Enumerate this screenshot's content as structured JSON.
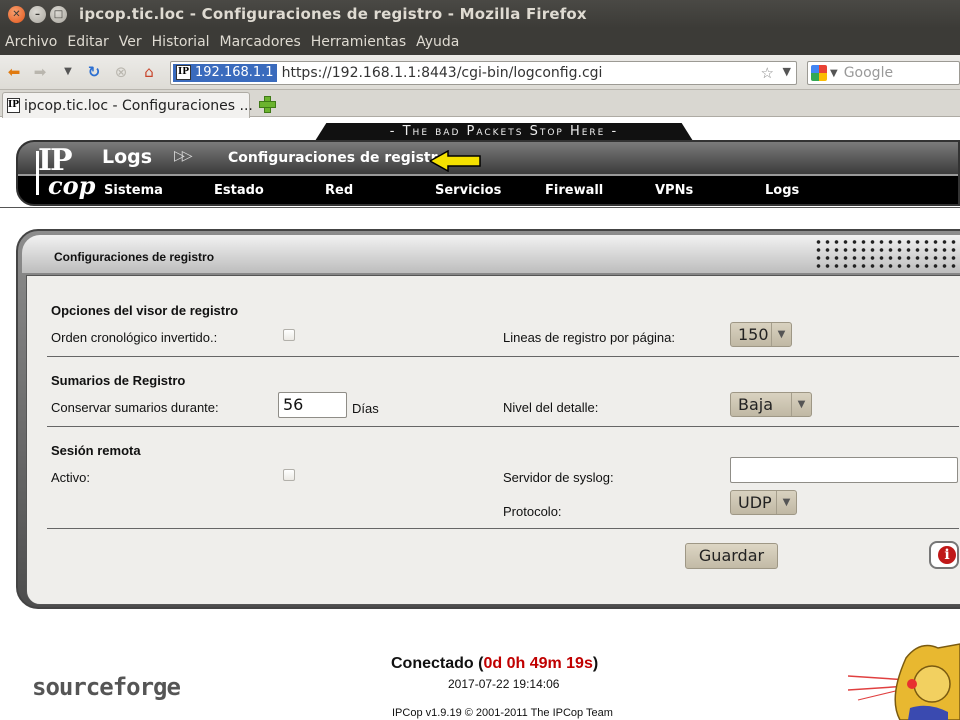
{
  "window": {
    "title": "ipcop.tic.loc - Configuraciones de registro - Mozilla Firefox"
  },
  "menubar": [
    "Archivo",
    "Editar",
    "Ver",
    "Historial",
    "Marcadores",
    "Herramientas",
    "Ayuda"
  ],
  "urlbar": {
    "site_identity": "192.168.1.1",
    "url": "https://192.168.1.1:8443/cgi-bin/logconfig.cgi"
  },
  "search": {
    "placeholder": "Google"
  },
  "tab": {
    "label": "ipcop.tic.loc - Configuraciones ..."
  },
  "header": {
    "slogan": "- The bad Packets Stop Here -",
    "logo_text": {
      "ip": "IP",
      "cop": "cop"
    },
    "section_title": "Logs",
    "page_subtitle": "Configuraciones de registro",
    "nav": [
      "Sistema",
      "Estado",
      "Red",
      "Servicios",
      "Firewall",
      "VPNs",
      "Logs"
    ]
  },
  "panel": {
    "title": "Configuraciones de registro",
    "viewer": {
      "heading": "Opciones del visor de registro",
      "reverse_label": "Orden cronológico invertido.:",
      "lines_label": "Lineas de registro por página:",
      "lines_value": "150"
    },
    "summaries": {
      "heading": "Sumarios de Registro",
      "keep_label": "Conservar sumarios durante:",
      "keep_value": "56",
      "keep_unit": "Días",
      "detail_label": "Nivel del detalle:",
      "detail_value": "Baja"
    },
    "remote": {
      "heading": "Sesión remota",
      "active_label": "Activo:",
      "server_label": "Servidor de syslog:",
      "server_value": "",
      "protocol_label": "Protocolo:",
      "protocol_value": "UDP"
    },
    "save_label": "Guardar",
    "info_icon_glyph": "i"
  },
  "footer": {
    "sourceforge": "sourceforge",
    "connected_label": "Conectado (",
    "uptime": "0d 0h 49m 19s",
    "connected_close": ")",
    "datetime": "2017-07-22 19:14:06",
    "copyright": "IPCop v1.9.19 © 2001-2011 The IPCop Team"
  },
  "colors": {
    "uptime": "#c00000",
    "site_identity_bg": "#3a6bbd",
    "pointer_arrow": "#f5e100"
  }
}
